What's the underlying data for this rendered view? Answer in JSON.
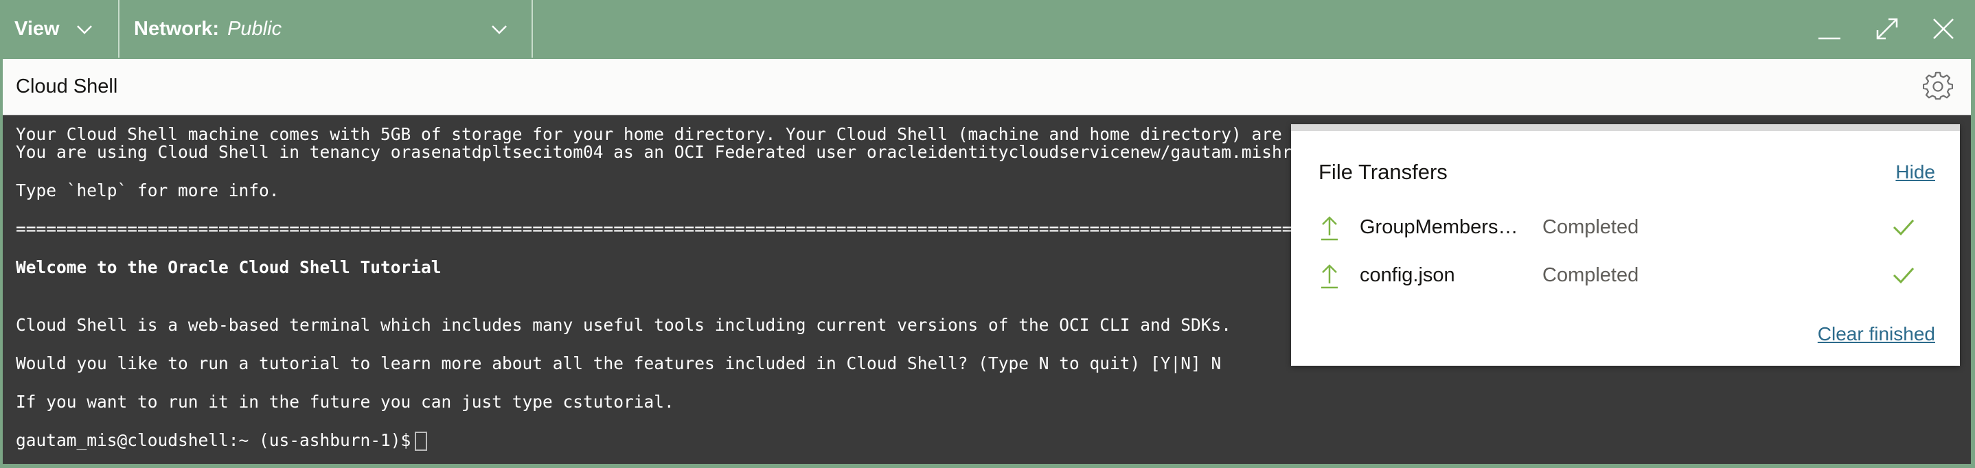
{
  "topbar": {
    "view_label": "View",
    "network_label": "Network:",
    "network_value": "Public"
  },
  "panel": {
    "title": "Cloud Shell"
  },
  "terminal": {
    "lines": [
      "Your Cloud Shell machine comes with 5GB of storage for your home directory. Your Cloud Shell (machine and home directory) are located",
      "You are using Cloud Shell in tenancy orasenatdpltsecitom04 as an OCI Federated user oracleidentitycloudservicenew/gautam.mishra@oracl",
      "Type `help` for more info.",
      "======================================================================================================================================",
      "Welcome to the Oracle Cloud Shell Tutorial",
      "Cloud Shell is a web-based terminal which includes many useful tools including current versions of the OCI CLI and SDKs.",
      "Would you like to run a tutorial to learn more about all the features included in Cloud Shell? (Type N to quit) [Y|N] N",
      "If you want to run it in the future you can just type cstutorial.",
      "gautam_mis@cloudshell:~ (us-ashburn-1)$"
    ]
  },
  "file_transfers": {
    "title": "File Transfers",
    "hide_label": "Hide",
    "items": [
      {
        "name": "GroupMembers…",
        "status": "Completed"
      },
      {
        "name": "config.json",
        "status": "Completed"
      }
    ],
    "clear_label": "Clear finished"
  },
  "icons": {
    "view_chevron": "chevron-down-icon",
    "network_chevron": "chevron-down-icon",
    "minimize": "minimize-icon",
    "maximize": "maximize-icon",
    "close": "close-icon",
    "settings": "gear-icon",
    "upload": "upload-arrow-icon",
    "completed": "check-icon"
  },
  "colors": {
    "topbar_bg": "#7ba585",
    "terminal_bg": "#3a3a3a",
    "link": "#2c6b8c",
    "success_green": "#7cb342"
  }
}
